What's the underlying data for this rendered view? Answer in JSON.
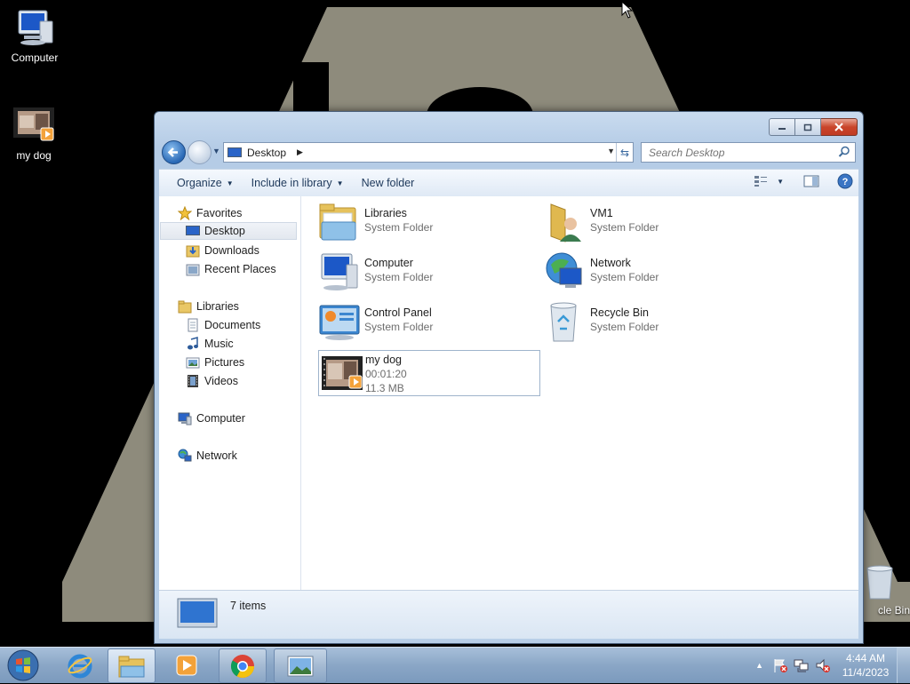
{
  "desktop": {
    "icons": [
      {
        "label": "Computer",
        "icon": "computer-icon"
      },
      {
        "label": "my dog",
        "icon": "video-thumbnail-icon"
      },
      {
        "label": "cle Bin",
        "icon": "recycle-bin-icon"
      }
    ]
  },
  "window": {
    "caption_buttons": [
      "minimize",
      "maximize",
      "close"
    ],
    "address": {
      "location": "Desktop"
    },
    "search": {
      "placeholder": "Search Desktop"
    },
    "toolbar": {
      "organize": "Organize",
      "include_in_library": "Include in library",
      "new_folder": "New folder"
    },
    "nav_pane": {
      "favorites": "Favorites",
      "desktop": "Desktop",
      "downloads": "Downloads",
      "recent_places": "Recent Places",
      "libraries": "Libraries",
      "documents": "Documents",
      "music": "Music",
      "pictures": "Pictures",
      "videos": "Videos",
      "computer": "Computer",
      "network": "Network"
    },
    "items": [
      {
        "name": "Libraries",
        "sub1": "System Folder",
        "sub2": ""
      },
      {
        "name": "VM1",
        "sub1": "System Folder",
        "sub2": ""
      },
      {
        "name": "Computer",
        "sub1": "System Folder",
        "sub2": ""
      },
      {
        "name": "Network",
        "sub1": "System Folder",
        "sub2": ""
      },
      {
        "name": "Control Panel",
        "sub1": "System Folder",
        "sub2": ""
      },
      {
        "name": "Recycle Bin",
        "sub1": "System Folder",
        "sub2": ""
      },
      {
        "name": "my dog",
        "sub1": "00:01:20",
        "sub2": "11.3 MB"
      }
    ],
    "details": {
      "count": "7 items"
    }
  },
  "taskbar": {
    "pinned": [
      "internet-explorer",
      "windows-explorer",
      "media-player",
      "chrome",
      "photo-viewer"
    ],
    "clock": {
      "time": "4:44 AM",
      "date": "11/4/2023"
    }
  },
  "colors": {
    "selection": "#cfd8e4",
    "link_text": "#1e395b",
    "accent": "#3a75c4"
  }
}
